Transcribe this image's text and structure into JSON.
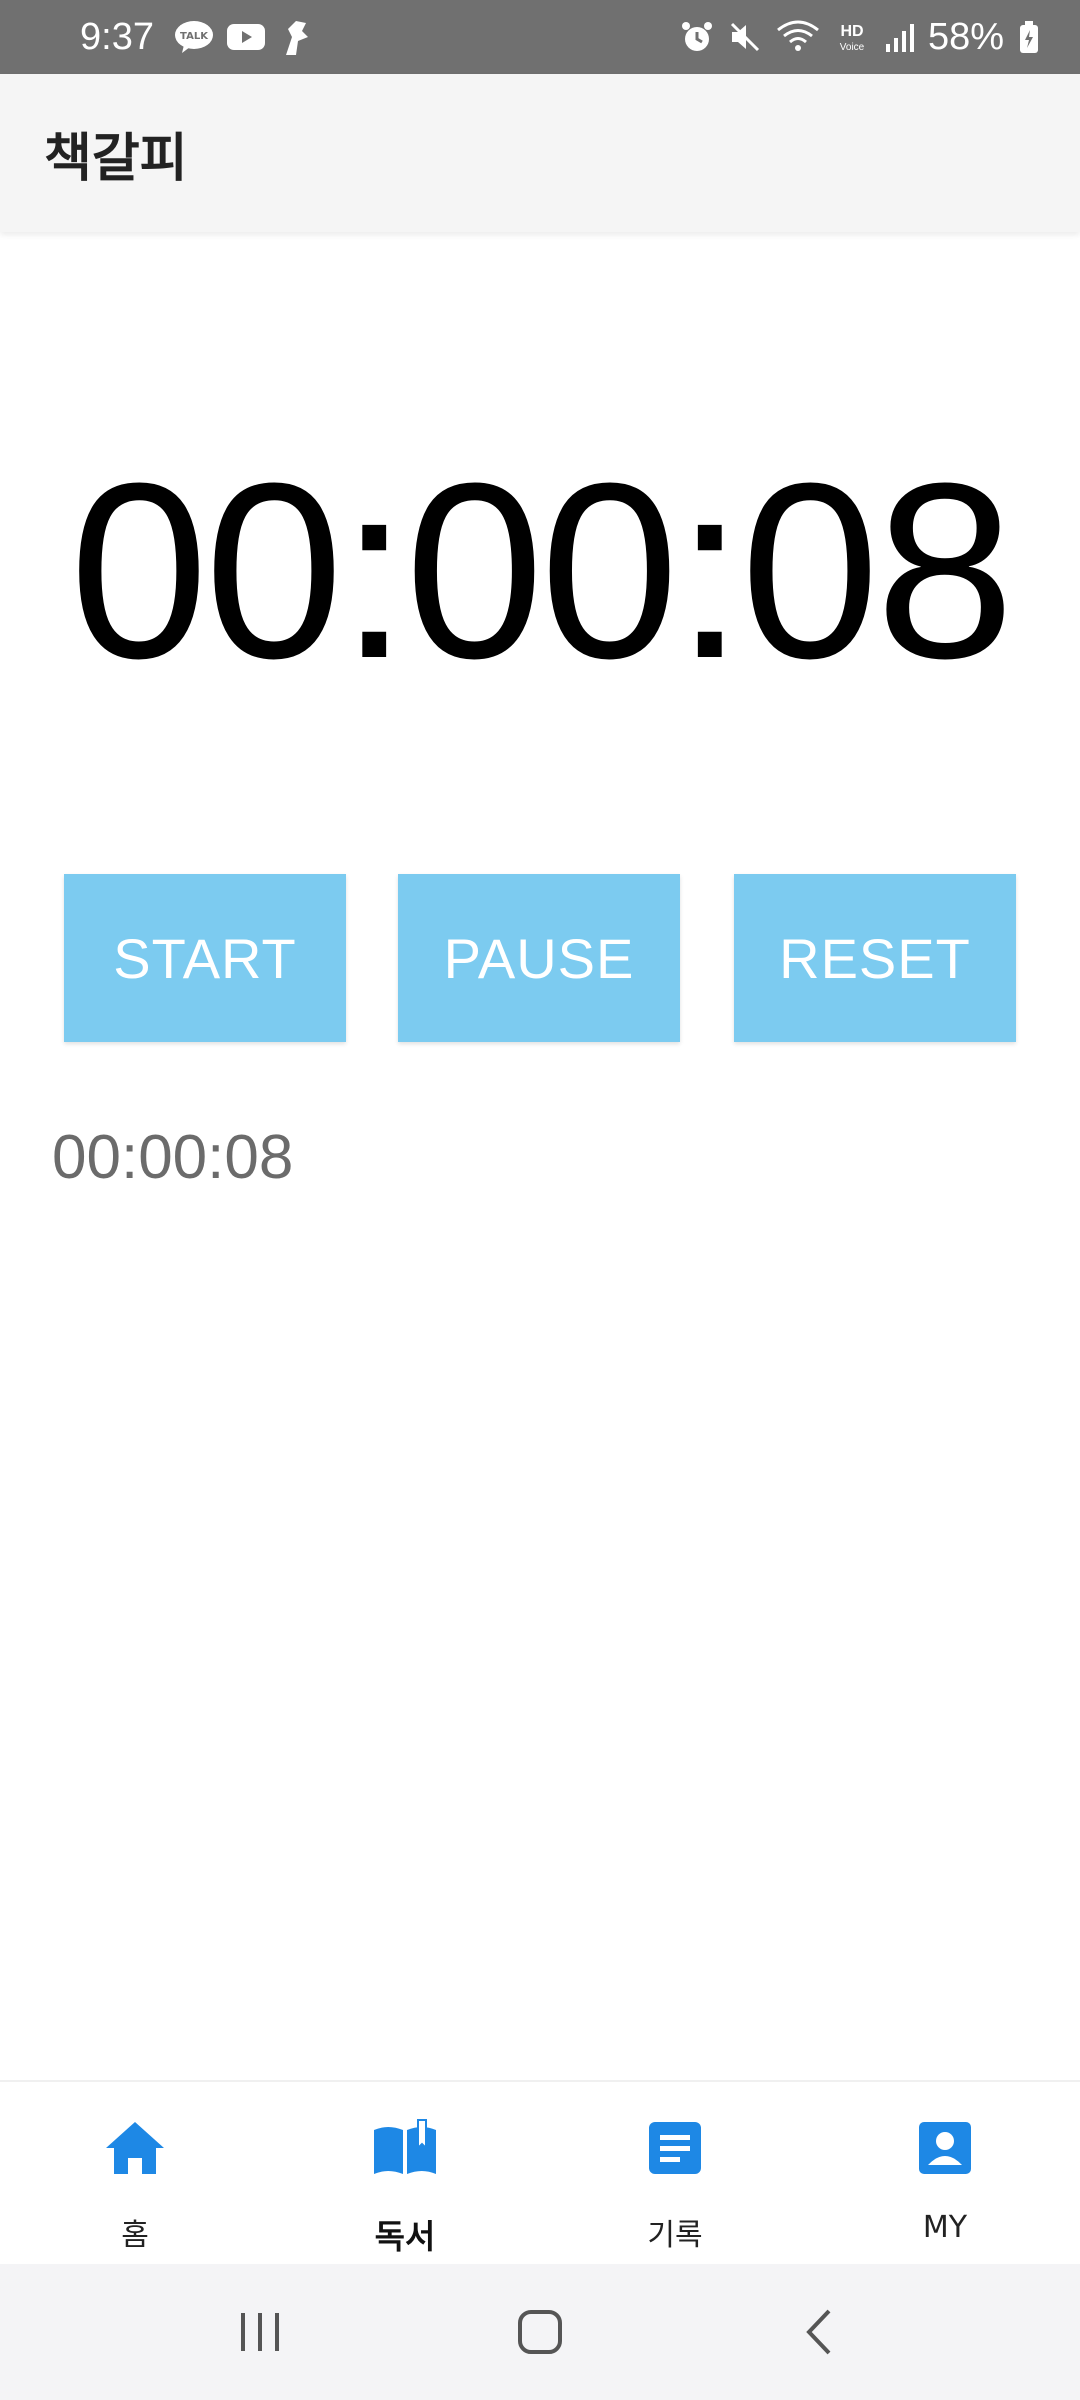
{
  "status_bar": {
    "time": "9:37",
    "battery": "58%",
    "left_icons": [
      "kakaotalk-icon",
      "youtube-icon",
      "app-icon"
    ],
    "right_icons": [
      "alarm-icon",
      "mute-icon",
      "wifi-icon",
      "hd-voice-icon",
      "signal-icon",
      "battery-icon"
    ]
  },
  "app_bar": {
    "title": "책갈피"
  },
  "timer": {
    "display": "00:00:08"
  },
  "controls": {
    "start_label": "START",
    "pause_label": "PAUSE",
    "reset_label": "RESET",
    "button_color": "#7ccbf0"
  },
  "laps": {
    "items": [
      "00:00:08"
    ]
  },
  "bottom_nav": {
    "accent_color": "#1e88e5",
    "items": [
      {
        "label": "홈",
        "icon": "home-icon",
        "active": false
      },
      {
        "label": "독서",
        "icon": "open-book-icon",
        "active": true
      },
      {
        "label": "기록",
        "icon": "notes-icon",
        "active": false
      },
      {
        "label": "MY",
        "icon": "profile-icon",
        "active": false
      }
    ]
  },
  "system_nav": {
    "icons": [
      "recent-apps-icon",
      "home-button-icon",
      "back-icon"
    ]
  }
}
